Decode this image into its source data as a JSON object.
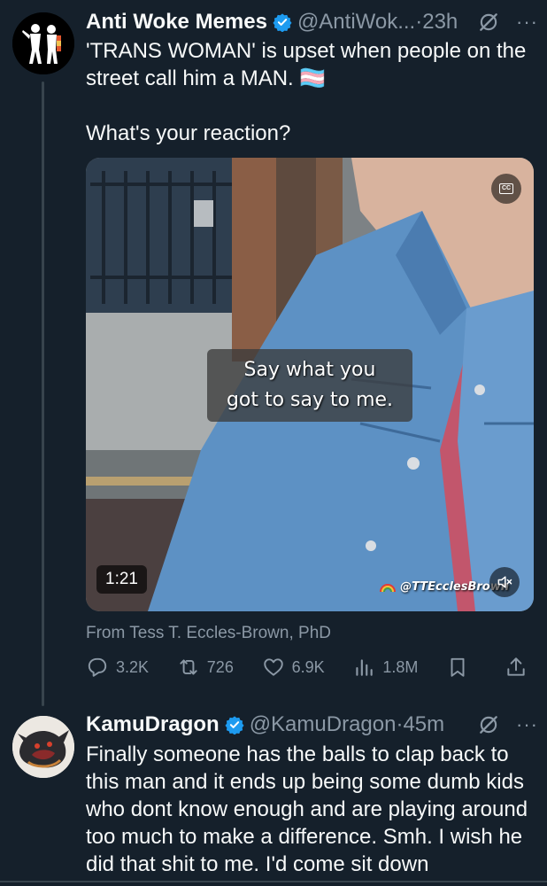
{
  "tweet1": {
    "author_name": "Anti Woke Memes",
    "author_handle": "@AntiWok...",
    "time": "·23h",
    "more": "···",
    "text": "'TRANS WOMAN' is upset when people on the street call him a MAN. 🏳️‍⚧️\n\nWhat's your reaction?",
    "media": {
      "caption": "Say what you\ngot to say to me.",
      "cc_label": "CC",
      "duration": "1:21",
      "watermark": "@TTEcclesBrown"
    },
    "from": "From Tess T. Eccles-Brown, PhD",
    "actions": {
      "replies": "3.2K",
      "reposts": "726",
      "likes": "6.9K",
      "views": "1.8M"
    }
  },
  "tweet2": {
    "author_name": "KamuDragon",
    "author_handle": "@KamuDragon",
    "time": "·45m",
    "more": "···",
    "text": "Finally someone has the balls to clap back to this man and it ends up being some dumb kids who dont know enough and are playing around too much to make a difference. Smh. I wish he did that shit to me. I'd come sit down"
  },
  "colors": {
    "background": "#15202b",
    "text_primary": "#f7f9f9",
    "text_secondary": "#8b98a5",
    "verified": "#1d9bf0",
    "divider": "#38444d"
  },
  "icons": [
    "verified-badge-icon",
    "grok-icon",
    "more-icon",
    "reply-icon",
    "repost-icon",
    "like-icon",
    "views-icon",
    "bookmark-icon",
    "share-icon",
    "cc-icon",
    "mute-icon"
  ]
}
